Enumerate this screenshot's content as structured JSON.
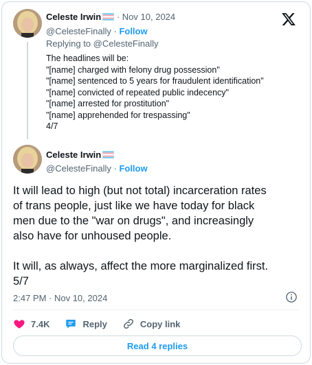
{
  "tweet1": {
    "author_name": "Celeste Irwin",
    "date": "Nov 10, 2024",
    "date_separator": "·",
    "handle": "@CelesteFinally",
    "handle_separator": "·",
    "follow_label": "Follow",
    "replying_to": "Replying to @CelesteFinally",
    "body_lines": [
      "The headlines will be:",
      "\"[name] charged with felony drug possession\"",
      "\"[name] sentenced to 5 years for fraudulent identification\"",
      "\"[name] convicted of repeated public indecency\"",
      "\"[name] arrested for prostitution\"",
      "\"[name] apprehended for trespassing\"",
      "4/7"
    ]
  },
  "tweet2": {
    "author_name": "Celeste Irwin",
    "handle": "@CelesteFinally",
    "handle_separator": "·",
    "follow_label": "Follow",
    "body_lines": [
      "It will lead to high (but not total) incarceration rates",
      "of trans people, just like we have today for black",
      "men due to the \"war on drugs\", and increasingly",
      "also have for unhoused people.",
      "",
      "It will, as always, affect the more marginalized first.",
      "5/7"
    ],
    "timestamp": "2:47 PM · Nov 10, 2024"
  },
  "actions": {
    "like_count": "7.4K",
    "reply_label": "Reply",
    "copy_link_label": "Copy link"
  },
  "read_replies_label": "Read 4 replies",
  "icons": {
    "logo": "x-logo-icon",
    "flag": "trans-flag-icon",
    "like": "heart-icon",
    "reply": "reply-bubble-icon",
    "copy": "link-icon",
    "info": "info-icon"
  },
  "colors": {
    "accent": "#1d9bf0",
    "like": "#f91880",
    "muted": "#536471",
    "border": "#cfd9de"
  }
}
